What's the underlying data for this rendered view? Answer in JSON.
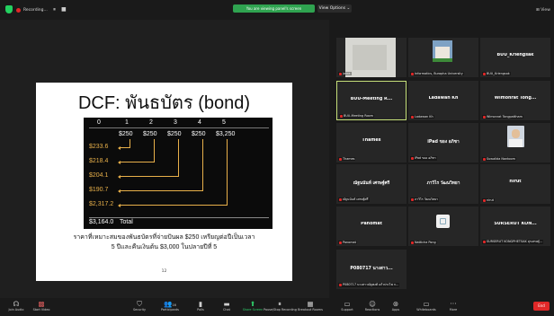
{
  "top_bar": {
    "recording_label": "Recording...",
    "pause_icon": "⏸",
    "stop_icon": "■",
    "share_banner": "You are viewing panel's screen",
    "view_options": "View Options ⌄",
    "view_button": "⊞ View"
  },
  "slide": {
    "title": "DCF: พันธบัตร (bond)",
    "periods": [
      "0",
      "1",
      "2",
      "3",
      "4",
      "5"
    ],
    "cash_flows": [
      "$250",
      "$250",
      "$250",
      "$250",
      "$3,250"
    ],
    "present_values": [
      "$233.6",
      "$218.4",
      "$204.1",
      "$190.7",
      "$2,317.2"
    ],
    "total_value": "$3,164.0",
    "total_label": "Total",
    "caption_line1": "ราคาที่เหมาะสมของพันธบัตรที่จ่ายปันผล $250 เหรียญต่อปีเป็นเวลา",
    "caption_line2": "5 ปีและคืนเงินต้น $3,000 ในปลายปีที่ 5",
    "page_number": "12"
  },
  "participants": [
    {
      "name": "",
      "label": "Jakra",
      "kind": "video"
    },
    {
      "name": "",
      "label": "Informatics, Burapha University",
      "kind": "building"
    },
    {
      "name": "BUU_Kriengsak",
      "label": "BUU_Kriengsak",
      "kind": "name"
    },
    {
      "name": "BUU-Meeting R...",
      "label": "BUU-Meeting Room",
      "kind": "name",
      "active": true
    },
    {
      "name": "Ladawan Kh",
      "label": "Ladawan Kh",
      "kind": "name"
    },
    {
      "name": "Wimonrat Tong...",
      "label": "Wimonrat Tongpattham",
      "kind": "name"
    },
    {
      "name": "Thames",
      "label": "Thames",
      "kind": "name"
    },
    {
      "name": "iPad ของ อภิชา",
      "label": "iPad ของ อภิชา",
      "kind": "name"
    },
    {
      "name": "",
      "label": "Suwalida Nantoom",
      "kind": "photo"
    },
    {
      "name": "ณัฐนนันท์ เศรษฐ์ศรี",
      "label": "ณัฐนนันท์ เศรษฐ์ศรี",
      "kind": "name"
    },
    {
      "name": "ภาวิไร วัฒนวิทยา",
      "label": "ภาวิไร วัฒนวิทยา",
      "kind": "name"
    },
    {
      "name": "nirut",
      "label": "nirut",
      "kind": "name"
    },
    {
      "name": "Panomat",
      "label": "Panomat",
      "kind": "name"
    },
    {
      "name": "",
      "label": "Natticha Pong",
      "kind": "image"
    },
    {
      "name": "SURSERUT KON...",
      "label": "SURSERUT KONGPHETSAK สุรเสรษฐ์...",
      "kind": "name"
    },
    {
      "name": "P080717 นางสาว...",
      "label": "P080717 นางสาวณัฐพงศ์ แก้วประไพ ก...",
      "kind": "name"
    }
  ],
  "toolbar": {
    "join_audio": "Join Audio",
    "start_video": "Start Video",
    "security": "Security",
    "participants": "Participants",
    "participants_count": "16",
    "polls": "Polls",
    "chat": "Chat",
    "share_screen": "Share Screen",
    "pause_recording": "Pause/Stop Recording",
    "breakout": "Breakout Rooms",
    "support": "Support",
    "reactions": "Reactions",
    "apps": "Apps",
    "whiteboards": "Whiteboards",
    "more": "More",
    "end": "End"
  },
  "colors": {
    "accent_green": "#2fce6a",
    "end_red": "#e02828",
    "slide_gold": "#e8b04a",
    "active_border": "#c6e07a"
  }
}
